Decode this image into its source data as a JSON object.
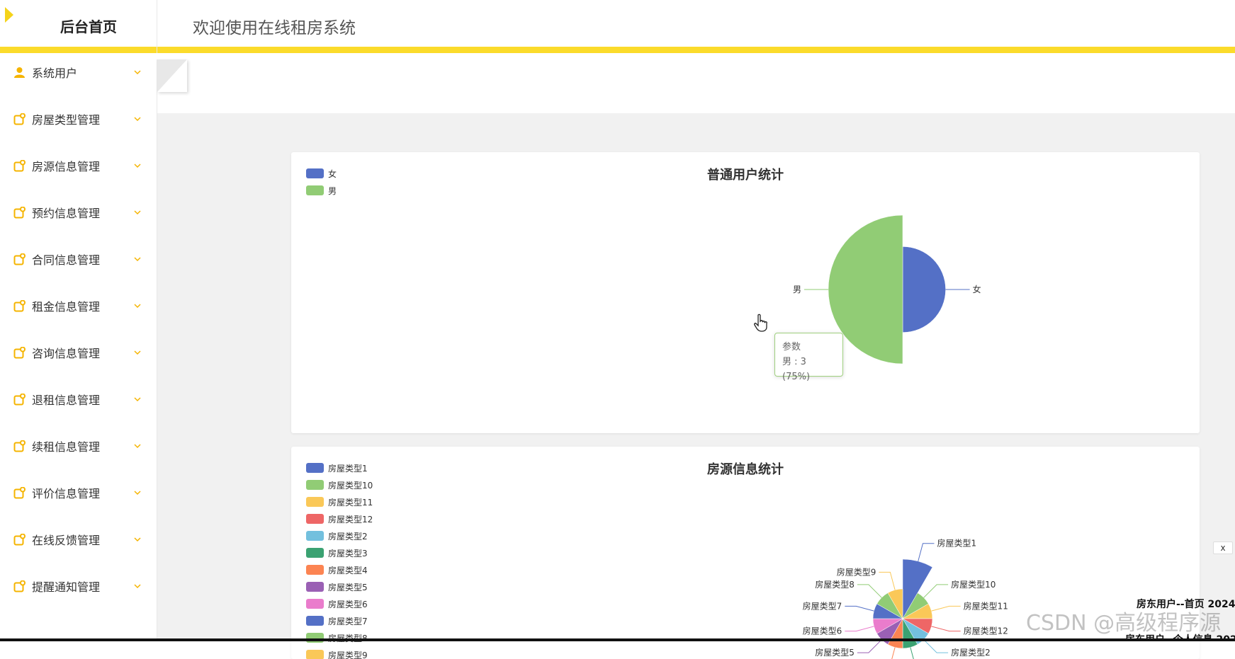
{
  "header": {
    "brand_title": "后台首页",
    "welcome": "欢迎使用在线租房系统",
    "accent_color": "#fbdb2b"
  },
  "sidebar": {
    "items": [
      {
        "label": "系统用户",
        "icon": "user-icon"
      },
      {
        "label": "房屋类型管理",
        "icon": "note-icon"
      },
      {
        "label": "房源信息管理",
        "icon": "note-icon"
      },
      {
        "label": "预约信息管理",
        "icon": "note-icon"
      },
      {
        "label": "合同信息管理",
        "icon": "note-icon"
      },
      {
        "label": "租金信息管理",
        "icon": "note-icon"
      },
      {
        "label": "咨询信息管理",
        "icon": "note-icon"
      },
      {
        "label": "退租信息管理",
        "icon": "note-icon"
      },
      {
        "label": "续租信息管理",
        "icon": "note-icon"
      },
      {
        "label": "评价信息管理",
        "icon": "note-icon"
      },
      {
        "label": "在线反馈管理",
        "icon": "note-icon"
      },
      {
        "label": "提醒通知管理",
        "icon": "note-icon"
      }
    ],
    "icon_color": "#f5b400"
  },
  "tooltip": {
    "title": "参数",
    "text": "男 : 3 (75%)"
  },
  "chart_data": [
    {
      "type": "pie",
      "subtype": "rose",
      "title": "普通用户统计",
      "legend_position": "top-left",
      "categories": [
        "女",
        "男"
      ],
      "values": [
        1,
        3
      ],
      "colors": [
        "#5470c6",
        "#91cc75"
      ]
    },
    {
      "type": "pie",
      "subtype": "rose",
      "title": "房源信息统计",
      "legend_position": "top-left",
      "categories": [
        "房屋类型1",
        "房屋类型10",
        "房屋类型11",
        "房屋类型12",
        "房屋类型2",
        "房屋类型3",
        "房屋类型4",
        "房屋类型5",
        "房屋类型6",
        "房屋类型7",
        "房屋类型8",
        "房屋类型9"
      ],
      "values": [
        8,
        2,
        2,
        2,
        2,
        2,
        2,
        2,
        2,
        2,
        2,
        2
      ],
      "colors": [
        "#5470c6",
        "#91cc75",
        "#fac858",
        "#ee6666",
        "#73c0de",
        "#3ba272",
        "#fc8452",
        "#9a60b4",
        "#ea7ccc",
        "#5470c6",
        "#91cc75",
        "#fac858"
      ]
    }
  ],
  "overlay": {
    "close_label": "x",
    "ticker1": "房东用户--首页 2024-",
    "ticker2": "房东用户--个人信息 202",
    "watermark": "CSDN @高级程序源"
  }
}
